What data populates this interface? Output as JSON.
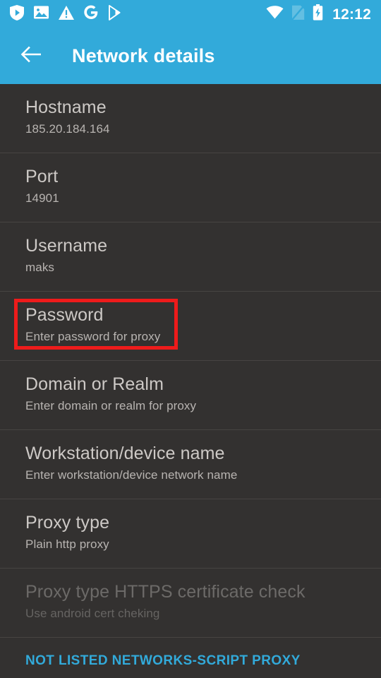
{
  "status_bar": {
    "time": "12:12",
    "left_icons": [
      "shield-play-icon",
      "image-icon",
      "warning-triangle-icon",
      "google-g-icon",
      "play-store-icon"
    ],
    "right_icons": [
      "wifi-icon",
      "no-sim-icon",
      "battery-charging-icon"
    ]
  },
  "app_bar": {
    "back_icon": "arrow-back-icon",
    "title": "Network details",
    "background_color": "#32aada"
  },
  "colors": {
    "accent": "#32aada",
    "background": "#333130",
    "divider": "#474442",
    "primary_text": "#cdc9c6",
    "secondary_text": "#b8b4b1",
    "disabled_text": "#6c6a68",
    "highlight_box": "#ee1b1b"
  },
  "settings_rows": [
    {
      "title": "Hostname",
      "subtitle": "185.20.184.164",
      "disabled": false,
      "highlighted": false
    },
    {
      "title": "Port",
      "subtitle": "14901",
      "disabled": false,
      "highlighted": false
    },
    {
      "title": "Username",
      "subtitle": "maks",
      "disabled": false,
      "highlighted": false
    },
    {
      "title": "Password",
      "subtitle": "Enter password for proxy",
      "disabled": false,
      "highlighted": true
    },
    {
      "title": "Domain or Realm",
      "subtitle": "Enter domain or realm for proxy",
      "disabled": false,
      "highlighted": false
    },
    {
      "title": "Workstation/device name",
      "subtitle": "Enter workstation/device network name",
      "disabled": false,
      "highlighted": false
    },
    {
      "title": "Proxy type",
      "subtitle": "Plain http proxy",
      "disabled": false,
      "highlighted": false
    },
    {
      "title": "Proxy type HTTPS certificate check",
      "subtitle": "Use android cert cheking",
      "disabled": true,
      "highlighted": false
    }
  ],
  "footer": {
    "link_label": "NOT LISTED NETWORKS-SCRIPT PROXY"
  }
}
